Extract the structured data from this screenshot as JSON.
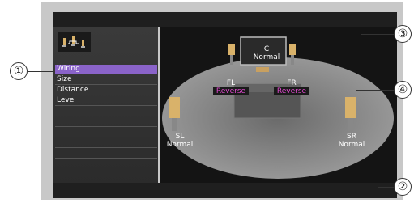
{
  "menu": {
    "items": [
      {
        "label": "Wiring",
        "selected": true
      },
      {
        "label": "Size",
        "selected": false
      },
      {
        "label": "Distance",
        "selected": false
      },
      {
        "label": "Level",
        "selected": false
      },
      {
        "label": "",
        "selected": false
      },
      {
        "label": "",
        "selected": false
      },
      {
        "label": "",
        "selected": false
      },
      {
        "label": "",
        "selected": false
      },
      {
        "label": "",
        "selected": false
      }
    ]
  },
  "speakers": {
    "c": {
      "name": "C",
      "value": "Normal"
    },
    "fl": {
      "name": "FL",
      "value": "Reverse"
    },
    "fr": {
      "name": "FR",
      "value": "Reverse"
    },
    "sl": {
      "name": "SL",
      "value": "Normal"
    },
    "sr": {
      "name": "SR",
      "value": "Normal"
    }
  },
  "callouts": [
    "①",
    "②",
    "③",
    "④"
  ],
  "colors": {
    "selected": "#8a63c9",
    "reverse": "#e64ad4",
    "panel": "#2b2b2b",
    "stage": "#141414",
    "frame": "#c8c8c8"
  }
}
